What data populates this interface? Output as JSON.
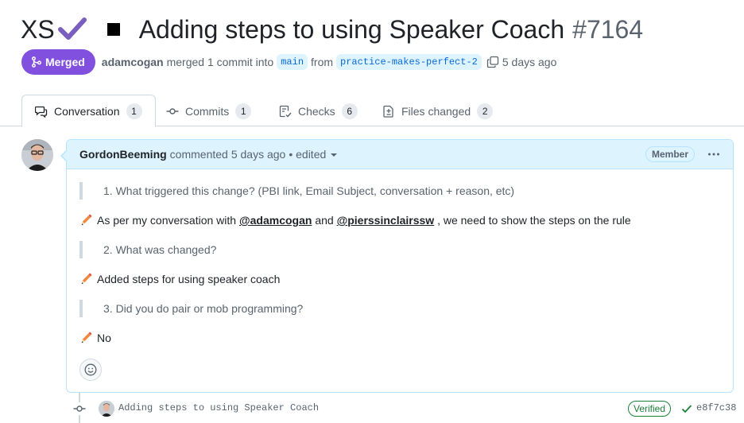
{
  "title": {
    "prefix": "XS",
    "text": "Adding steps to using Speaker Coach",
    "number": "#7164"
  },
  "meta": {
    "status_label": "Merged",
    "author": "adamcogan",
    "action": "merged 1 commit into",
    "base_branch": "main",
    "from_word": "from",
    "head_branch": "practice-makes-perfect-2",
    "time": "5 days ago"
  },
  "tabs": [
    {
      "label": "Conversation",
      "count": "1",
      "icon": "conversation-icon"
    },
    {
      "label": "Commits",
      "count": "1",
      "icon": "commit-icon"
    },
    {
      "label": "Checks",
      "count": "6",
      "icon": "checklist-icon"
    },
    {
      "label": "Files changed",
      "count": "2",
      "icon": "file-diff-icon"
    }
  ],
  "comment": {
    "author": "GordonBeeming",
    "action": "commented",
    "time": "5 days ago",
    "edited": "• edited",
    "role_badge": "Member",
    "blocks": [
      {
        "type": "quote",
        "text": "1. What triggered this change? (PBI link, Email Subject, conversation + reason, etc)"
      },
      {
        "type": "para",
        "pre": "As per my conversation with",
        "mention1": "@adamcogan",
        "mid": "and",
        "mention2": "@pierssinclairssw",
        "post": ", we need to show the steps on the rule"
      },
      {
        "type": "quote",
        "text": "2. What was changed?"
      },
      {
        "type": "para",
        "text": "Added steps for using speaker coach"
      },
      {
        "type": "quote",
        "text": "3. Did you do pair or mob programming?"
      },
      {
        "type": "para",
        "text": "No"
      }
    ]
  },
  "commit": {
    "message": "Adding steps to using Speaker Coach",
    "verified_label": "Verified",
    "sha": "e8f7c38"
  },
  "colors": {
    "merged": "#8250df",
    "link": "#0969da",
    "success": "#1a7f37",
    "comment_header_bg": "#ddf4ff",
    "pencil": "#f0883e"
  }
}
